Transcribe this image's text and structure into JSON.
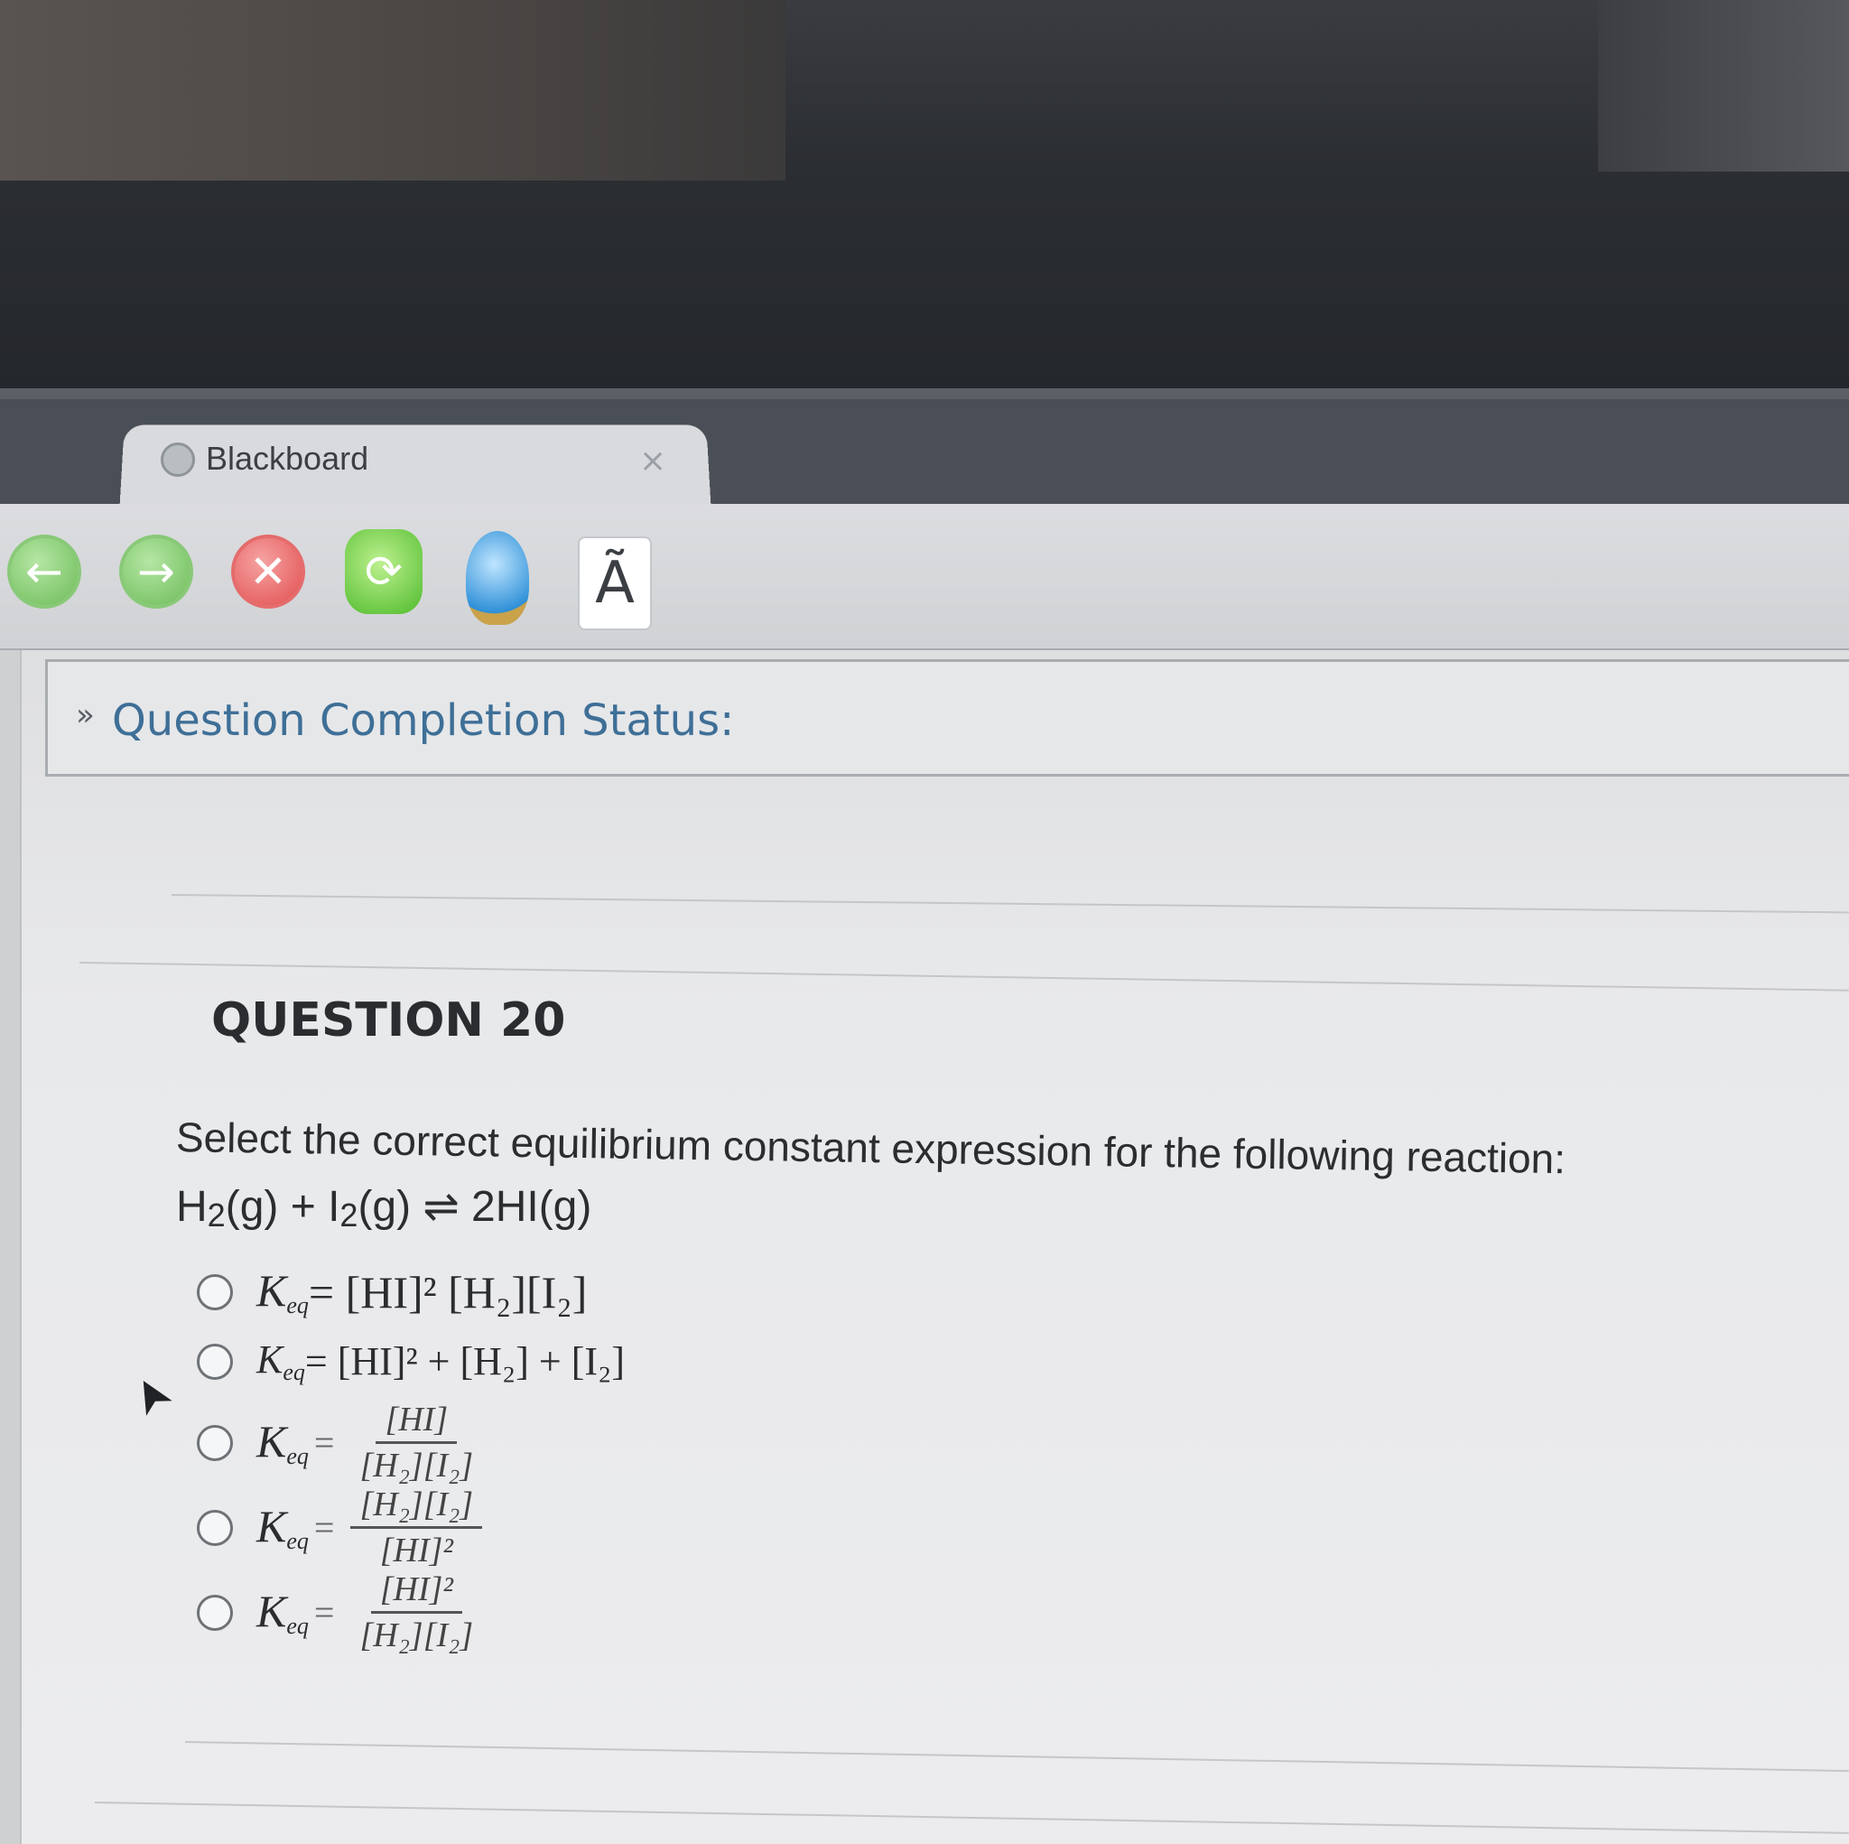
{
  "browser": {
    "tab_title": "Blackboard",
    "tab_close": "×",
    "toolbar": {
      "back_icon": "←",
      "forward_icon": "→",
      "stop_icon": "✕",
      "reload_icon": "⟳",
      "font_button": "Ã"
    }
  },
  "status": {
    "chevron": "»",
    "label": "Question Completion Status:"
  },
  "question": {
    "title": "QUESTION 20",
    "prompt": "Select the correct equilibrium constant expression for the following reaction:",
    "reaction": {
      "h": "H",
      "h_sub": "2",
      "h_state": "(g) + I",
      "i_sub": "2",
      "i_state": "(g) ⇌ 2HI(g)"
    },
    "options": [
      {
        "k": "K",
        "k_sub": "eq",
        "expr": " = [HI]² [H₂][I₂]"
      },
      {
        "k": "K",
        "k_sub": "eq",
        "expr": " = [HI]² + [H₂] + [I₂]"
      },
      {
        "k": "K",
        "k_sub": "eq",
        "eq": "=",
        "num": "[HI]",
        "den": "[H₂][I₂]"
      },
      {
        "k": "K",
        "k_sub": "eq",
        "eq": "=",
        "num": "[H₂][I₂]",
        "den": "[HI]²"
      },
      {
        "k": "K",
        "k_sub": "eq",
        "eq": "=",
        "num": "[HI]²",
        "den": "[H₂][I₂]"
      }
    ]
  },
  "cursor_icon": "➤"
}
